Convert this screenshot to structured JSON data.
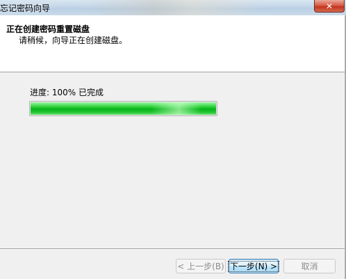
{
  "window": {
    "title": "忘记密码向导",
    "close_glyph": "✕"
  },
  "header": {
    "title": "正在创建密码重置磁盘",
    "subtitle": "请稍候，向导正在创建磁盘。"
  },
  "progress": {
    "label": "进度: 100% 已完成",
    "fraction": 1.0
  },
  "buttons": {
    "back": "< 上一步(B)",
    "next": "下一步(N) >",
    "cancel": "取消"
  },
  "colors": {
    "progress_green": "#07b31a",
    "close_red": "#c2341f",
    "default_button_border": "#3c7fb1"
  }
}
